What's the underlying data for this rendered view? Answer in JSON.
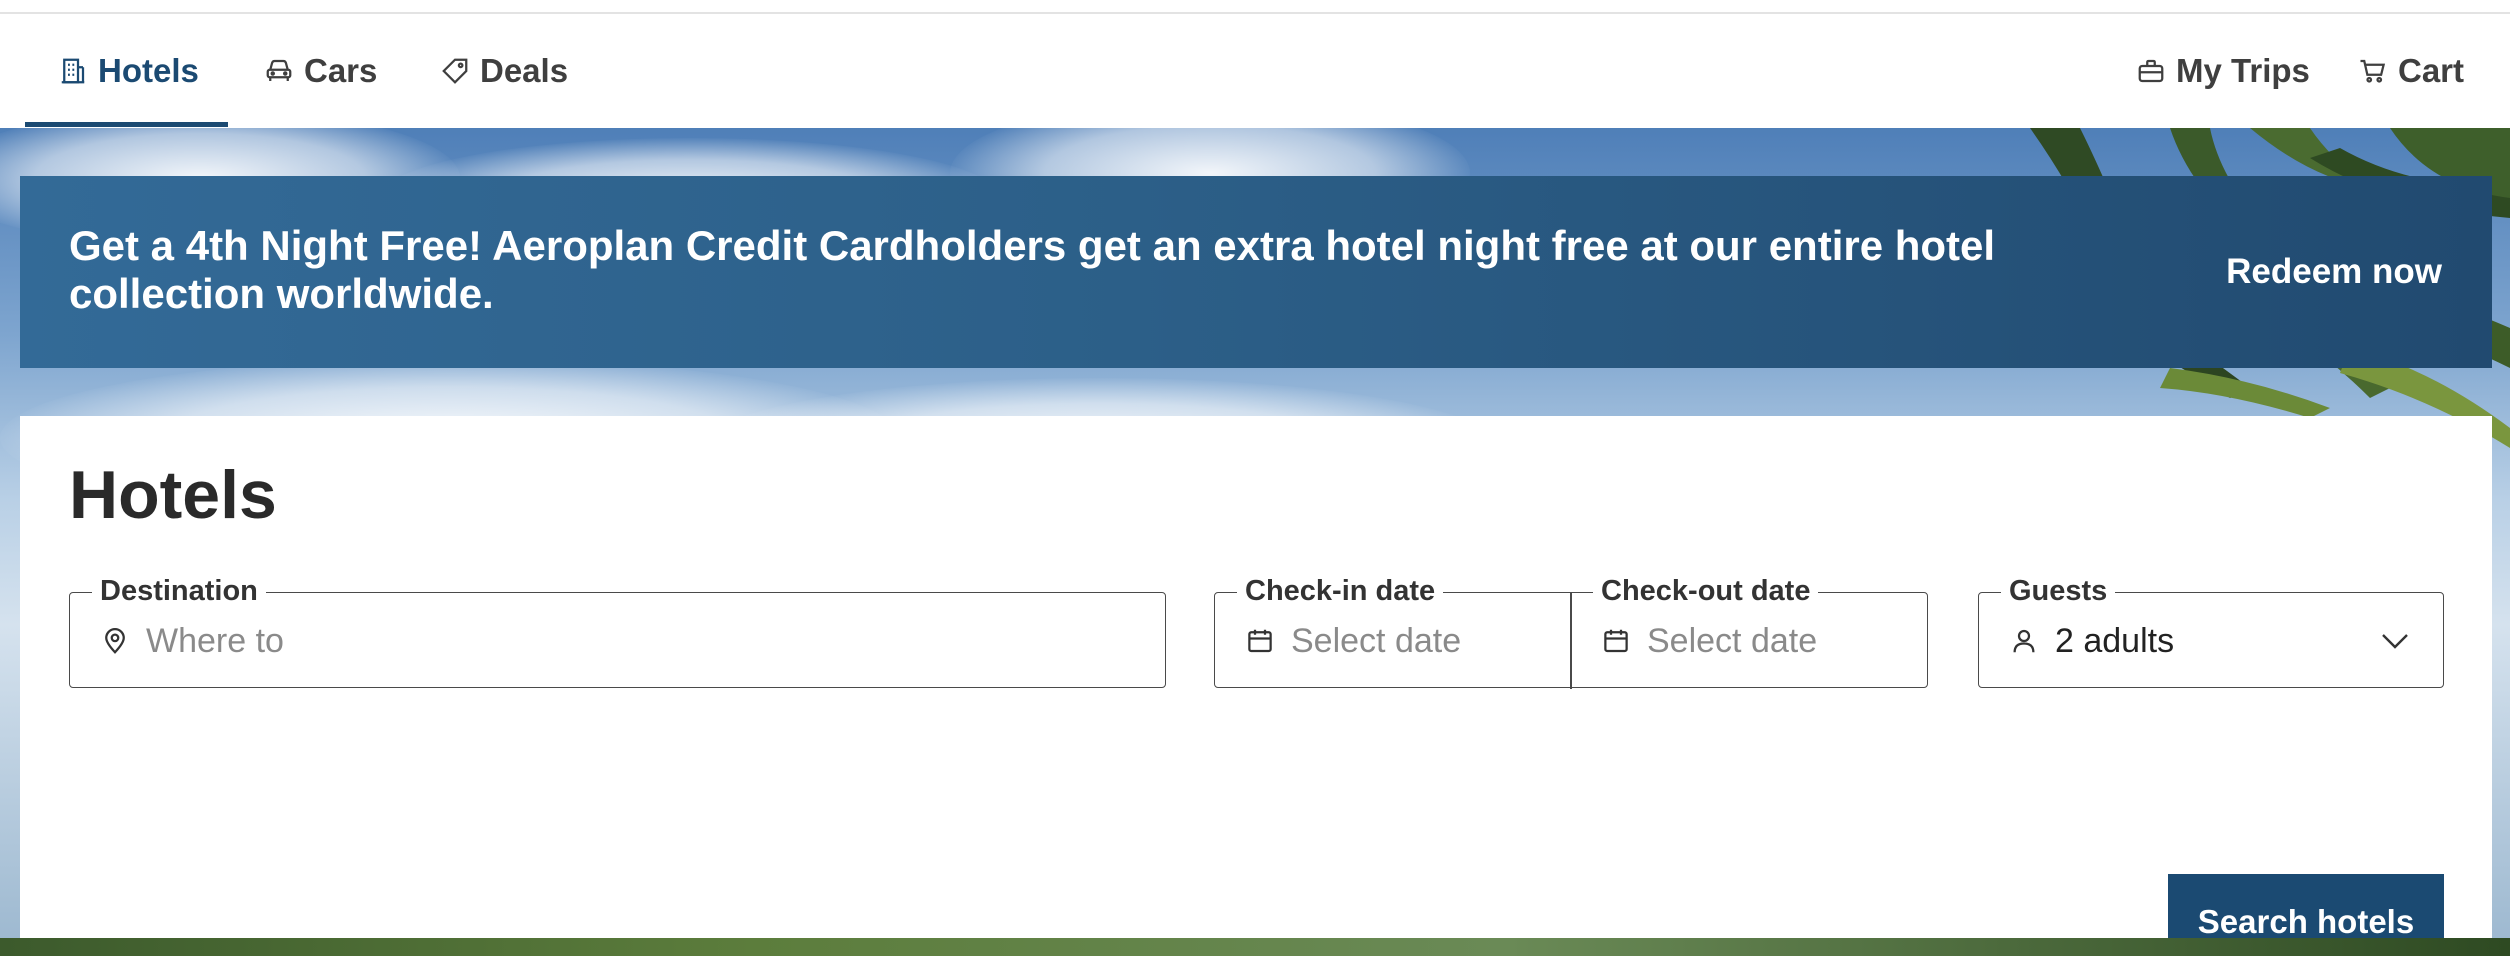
{
  "nav": {
    "tabs": [
      {
        "label": "Hotels",
        "icon": "building-icon",
        "active": true
      },
      {
        "label": "Cars",
        "icon": "car-icon",
        "active": false
      },
      {
        "label": "Deals",
        "icon": "tag-icon",
        "active": false
      }
    ],
    "right": [
      {
        "label": "My Trips",
        "icon": "suitcase-icon"
      },
      {
        "label": "Cart",
        "icon": "cart-icon"
      }
    ],
    "accent_color": "#1b4a72"
  },
  "promo": {
    "text": "Get a 4th Night Free! Aeroplan Credit Cardholders get an extra hotel night free at our entire hotel collection worldwide.",
    "link": "Redeem now",
    "background_color": "#2c5f88"
  },
  "search": {
    "title": "Hotels",
    "destination": {
      "label": "Destination",
      "placeholder": "Where to",
      "icon": "location-pin-icon"
    },
    "checkin": {
      "label": "Check-in date",
      "placeholder": "Select date",
      "icon": "calendar-icon"
    },
    "checkout": {
      "label": "Check-out date",
      "placeholder": "Select date",
      "icon": "calendar-icon"
    },
    "guests": {
      "label": "Guests",
      "value": "2 adults",
      "icon": "person-icon"
    },
    "button": "Search hotels",
    "button_color": "#1b4a72"
  }
}
